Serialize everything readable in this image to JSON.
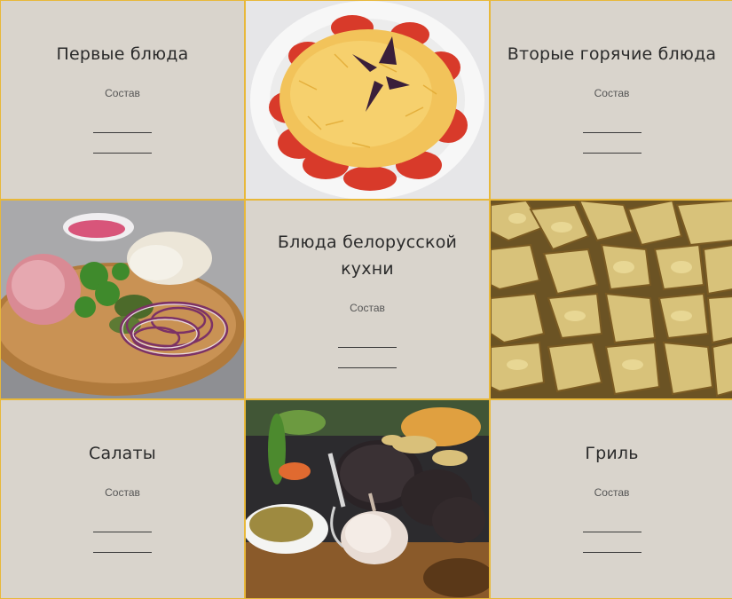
{
  "menu": {
    "items": [
      {
        "title": "Первые блюда",
        "subtitle": "Состав"
      },
      {
        "title": "Вторые горячие блюда",
        "subtitle": "Состав"
      },
      {
        "title": "Блюда белорусской кухни",
        "subtitle": "Состав"
      },
      {
        "title": "Салаты",
        "subtitle": "Состав"
      },
      {
        "title": "Гриль",
        "subtitle": "Состав"
      }
    ]
  },
  "photos": [
    {
      "name": "tomato-cheese-salad-photo"
    },
    {
      "name": "meat-onion-platter-photo"
    },
    {
      "name": "baked-potatoes-photo"
    },
    {
      "name": "blood-sausage-grill-photo"
    }
  ],
  "colors": {
    "tile_background": "#d9d4cc",
    "grid_border": "#e8b83a",
    "text": "#2b2b2b"
  }
}
